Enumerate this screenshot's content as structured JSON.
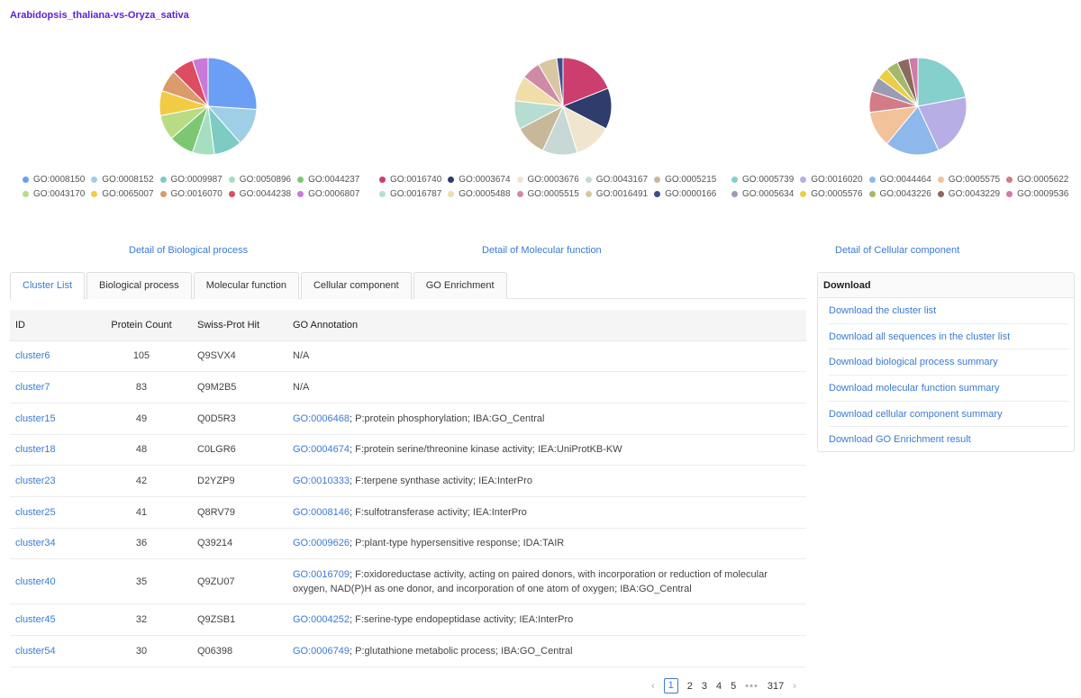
{
  "page_title": "Arabidopsis_thaliana-vs-Oryza_sativa",
  "chart_data": [
    {
      "type": "pie",
      "categories": [
        "GO:0008150",
        "GO:0008152",
        "GO:0009987",
        "GO:0050896",
        "GO:0044237",
        "GO:0043170",
        "GO:0065007",
        "GO:0016070",
        "GO:0044238",
        "GO:0006807"
      ],
      "values": [
        25,
        12,
        9,
        7,
        8,
        8,
        8,
        7,
        7,
        5
      ],
      "colors": [
        "#6b9ef5",
        "#9fcfe6",
        "#7ecbc3",
        "#a5dfc0",
        "#7cc872",
        "#b8dc84",
        "#f2cb45",
        "#d99c6a",
        "#dc4d62",
        "#c97ad8"
      ]
    },
    {
      "type": "pie",
      "categories": [
        "GO:0016740",
        "GO:0003674",
        "GO:0003676",
        "GO:0043167",
        "GO:0005215",
        "GO:0016787",
        "GO:0005488",
        "GO:0005515",
        "GO:0016491",
        "GO:0000166"
      ],
      "values": [
        18,
        13,
        12,
        11,
        10,
        9,
        8,
        6,
        6,
        2
      ],
      "colors": [
        "#cc3e6e",
        "#2e3d6b",
        "#f0e6cf",
        "#c8d8d5",
        "#c8b89a",
        "#b7ddd2",
        "#efdeaa",
        "#cf8ba5",
        "#d9c7a2",
        "#3e4c8e"
      ]
    },
    {
      "type": "pie",
      "categories": [
        "GO:0005739",
        "GO:0016020",
        "GO:0044464",
        "GO:0005575",
        "GO:0005622",
        "GO:0005634",
        "GO:0005576",
        "GO:0043226",
        "GO:0043229",
        "GO:0009536"
      ],
      "values": [
        22,
        21,
        18,
        12,
        7,
        5,
        4,
        4,
        4,
        3
      ],
      "colors": [
        "#85cfcd",
        "#b8aee6",
        "#8db8ec",
        "#f2c29b",
        "#d17c86",
        "#9b9bb4",
        "#e8cf45",
        "#a3b86a",
        "#8b6a5e",
        "#d279a8"
      ]
    }
  ],
  "detail_links": [
    "Detail of Biological process",
    "Detail of Molecular function",
    "Detail of Cellular component"
  ],
  "tabs": [
    {
      "label": "Cluster List",
      "active": true
    },
    {
      "label": "Biological process",
      "active": false
    },
    {
      "label": "Molecular function",
      "active": false
    },
    {
      "label": "Cellular component",
      "active": false
    },
    {
      "label": "GO Enrichment",
      "active": false
    }
  ],
  "table": {
    "headers": [
      "ID",
      "Protein Count",
      "Swiss-Prot Hit",
      "GO Annotation"
    ],
    "rows": [
      {
        "id": "cluster6",
        "count": "105",
        "hit": "Q9SVX4",
        "go": "",
        "annotation": "N/A"
      },
      {
        "id": "cluster7",
        "count": "83",
        "hit": "Q9M2B5",
        "go": "",
        "annotation": "N/A"
      },
      {
        "id": "cluster15",
        "count": "49",
        "hit": "Q0D5R3",
        "go": "GO:0006468",
        "annotation": "; P:protein phosphorylation; IBA:GO_Central"
      },
      {
        "id": "cluster18",
        "count": "48",
        "hit": "C0LGR6",
        "go": "GO:0004674",
        "annotation": "; F:protein serine/threonine kinase activity; IEA:UniProtKB-KW"
      },
      {
        "id": "cluster23",
        "count": "42",
        "hit": "D2YZP9",
        "go": "GO:0010333",
        "annotation": "; F:terpene synthase activity; IEA:InterPro"
      },
      {
        "id": "cluster25",
        "count": "41",
        "hit": "Q8RV79",
        "go": "GO:0008146",
        "annotation": "; F:sulfotransferase activity; IEA:InterPro"
      },
      {
        "id": "cluster34",
        "count": "36",
        "hit": "Q39214",
        "go": "GO:0009626",
        "annotation": "; P:plant-type hypersensitive response; IDA:TAIR"
      },
      {
        "id": "cluster40",
        "count": "35",
        "hit": "Q9ZU07",
        "go": "GO:0016709",
        "annotation": "; F:oxidoreductase activity, acting on paired donors, with incorporation or reduction of molecular oxygen, NAD(P)H as one donor, and incorporation of one atom of oxygen; IBA:GO_Central"
      },
      {
        "id": "cluster45",
        "count": "32",
        "hit": "Q9ZSB1",
        "go": "GO:0004252",
        "annotation": "; F:serine-type endopeptidase activity; IEA:InterPro"
      },
      {
        "id": "cluster54",
        "count": "30",
        "hit": "Q06398",
        "go": "GO:0006749",
        "annotation": "; P:glutathione metabolic process; IBA:GO_Central"
      }
    ]
  },
  "pagination": {
    "prev": "‹",
    "pages": [
      "1",
      "2",
      "3",
      "4",
      "5"
    ],
    "current": "1",
    "ellipsis": "•••",
    "last": "317",
    "next": "›"
  },
  "download": {
    "title": "Download",
    "items": [
      "Download the cluster list",
      "Download all sequences in the cluster list",
      "Download biological process summary",
      "Download molecular function summary",
      "Download cellular component summary",
      "Download GO Enrichment result"
    ]
  }
}
